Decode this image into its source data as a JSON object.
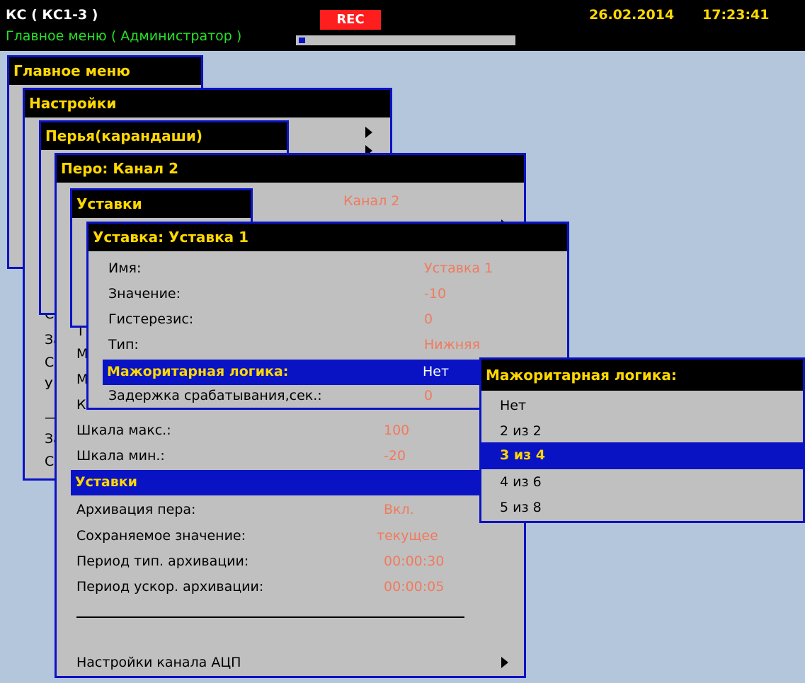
{
  "header": {
    "app_title": "КС ( КС1-3 )",
    "subtitle": "Главное меню ( Администратор )",
    "rec": "REC",
    "date": "26.02.2014",
    "time": "17:23:41",
    "progress": 0.03
  },
  "menus": {
    "main": {
      "title": "Главное меню"
    },
    "settings": {
      "title": "Настройки",
      "partial_items": [
        "С",
        "За",
        "С",
        "У",
        "—",
        "За",
        "С"
      ]
    },
    "pens": {
      "title": "Перья(карандаши)"
    },
    "pen": {
      "title": "Перо: Канал 2",
      "channel_value": "Канал 2",
      "partial_letters": [
        "Т",
        "М",
        "М",
        "К"
      ],
      "items": [
        {
          "label": "Шкала макс.:",
          "value": "100"
        },
        {
          "label": "Шкала мин.:",
          "value": "-20"
        },
        {
          "label": "Уставки",
          "value": ""
        },
        {
          "label": "Архивация пера:",
          "value": "Вкл."
        },
        {
          "label": "Сохраняемое значение:",
          "value": "текущее"
        },
        {
          "label": "Период тип. архивации:",
          "value": "00:00:30"
        },
        {
          "label": "Период ускор. архивации:",
          "value": "00:00:05"
        }
      ],
      "adc_label": "Настройки канала АЦП"
    },
    "setpoints": {
      "title": "Уставки"
    },
    "setpoint": {
      "title": "Уставка: Уставка 1",
      "items": [
        {
          "label": "Имя:",
          "value": "Уставка 1"
        },
        {
          "label": "Значение:",
          "value": "-10"
        },
        {
          "label": "Гистерезис:",
          "value": "0"
        },
        {
          "label": "Тип:",
          "value": "Нижняя"
        },
        {
          "label": "Мажоритарная логика:",
          "value": "Нет"
        },
        {
          "label": "Задержка срабатывания,сек.:",
          "value": "0"
        }
      ]
    },
    "majority": {
      "title": "Мажоритарная логика:",
      "options": [
        "Нет",
        "2 из 2",
        "3 из 4",
        "4 из 6",
        "5 из 8"
      ],
      "selected": "3 из 4"
    }
  },
  "colors": {
    "background": "#b4c6dc",
    "window": "#c0c0c0",
    "border": "#0a13c4",
    "title_bar": "#000000",
    "title_text": "#ffd800",
    "value_text": "#f07a5e",
    "selection": "#0a13c4",
    "rec": "#ff1e1e",
    "status_green": "#27e127"
  },
  "icons": [
    "submenu-arrow-icon"
  ]
}
